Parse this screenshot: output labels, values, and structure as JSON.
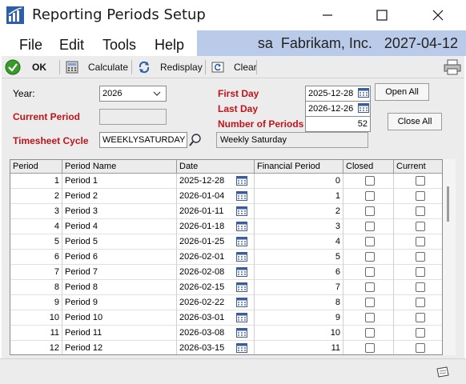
{
  "window": {
    "title": "Reporting Periods Setup"
  },
  "menu": {
    "items": [
      "File",
      "Edit",
      "Tools",
      "Help"
    ],
    "user": "sa",
    "company": "Fabrikam, Inc.",
    "date": "2027-04-12"
  },
  "toolbar": {
    "ok": "OK",
    "calculate": "Calculate",
    "redisplay": "Redisplay",
    "clear": "Clear"
  },
  "form": {
    "year_label": "Year:",
    "year_value": "2026",
    "current_period_label": "Current Period",
    "timesheet_cycle_label": "Timesheet Cycle",
    "timesheet_cycle_value": "WEEKLYSATURDAY",
    "timesheet_cycle_desc": "Weekly Saturday",
    "first_day_label": "First Day",
    "first_day_value": "2025-12-28",
    "last_day_label": "Last Day",
    "last_day_value": "2026-12-26",
    "num_periods_label": "Number of Periods",
    "num_periods_value": "52",
    "open_all": "Open All",
    "close_all": "Close All"
  },
  "grid": {
    "headers": [
      "Period",
      "Period Name",
      "Date",
      "Financial Period",
      "Closed",
      "Current"
    ],
    "rows": [
      {
        "period": "1",
        "name": "Period 1",
        "date": "2025-12-28",
        "fin": "0"
      },
      {
        "period": "2",
        "name": "Period 2",
        "date": "2026-01-04",
        "fin": "1"
      },
      {
        "period": "3",
        "name": "Period 3",
        "date": "2026-01-11",
        "fin": "2"
      },
      {
        "period": "4",
        "name": "Period 4",
        "date": "2026-01-18",
        "fin": "3"
      },
      {
        "period": "5",
        "name": "Period 5",
        "date": "2026-01-25",
        "fin": "4"
      },
      {
        "period": "6",
        "name": "Period 6",
        "date": "2026-02-01",
        "fin": "5"
      },
      {
        "period": "7",
        "name": "Period 7",
        "date": "2026-02-08",
        "fin": "6"
      },
      {
        "period": "8",
        "name": "Period 8",
        "date": "2026-02-15",
        "fin": "7"
      },
      {
        "period": "9",
        "name": "Period 9",
        "date": "2026-02-22",
        "fin": "8"
      },
      {
        "period": "10",
        "name": "Period 10",
        "date": "2026-03-01",
        "fin": "9"
      },
      {
        "period": "11",
        "name": "Period 11",
        "date": "2026-03-08",
        "fin": "10"
      },
      {
        "period": "12",
        "name": "Period 12",
        "date": "2026-03-15",
        "fin": "11"
      }
    ]
  },
  "colors": {
    "accent_menu": "#b9cbe8",
    "required_label": "#c0141b",
    "ok_green": "#3a9a2a"
  }
}
